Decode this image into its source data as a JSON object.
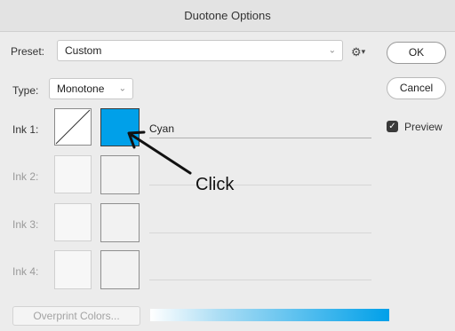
{
  "window": {
    "title": "Duotone Options"
  },
  "preset": {
    "label": "Preset:",
    "value": "Custom",
    "gear_icon": "gear-icon"
  },
  "type": {
    "label": "Type:",
    "value": "Monotone"
  },
  "buttons": {
    "ok": "OK",
    "cancel": "Cancel"
  },
  "preview": {
    "label": "Preview",
    "checked": true
  },
  "inks": [
    {
      "label": "Ink 1:",
      "name": "Cyan",
      "color": "#00a0e9",
      "enabled": true
    },
    {
      "label": "Ink 2:",
      "name": "",
      "color": "",
      "enabled": false
    },
    {
      "label": "Ink 3:",
      "name": "",
      "color": "",
      "enabled": false
    },
    {
      "label": "Ink 4:",
      "name": "",
      "color": "",
      "enabled": false
    }
  ],
  "overprint": {
    "label": "Overprint Colors..."
  },
  "annotation": {
    "text": "Click"
  },
  "colors": {
    "accent": "#00a0e9"
  }
}
